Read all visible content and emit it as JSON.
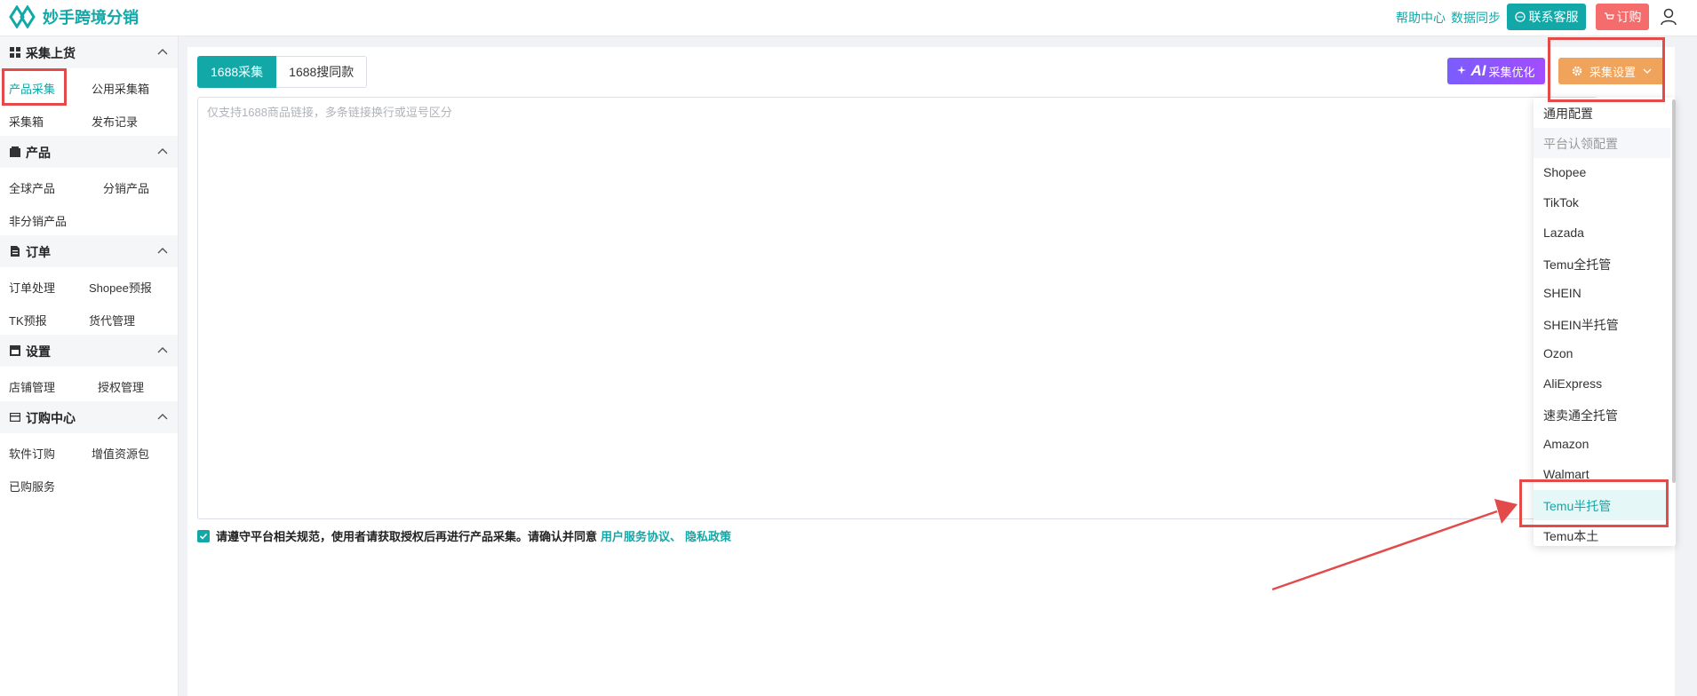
{
  "header": {
    "brand": "妙手跨境分销",
    "help_link": "帮助中心",
    "sync_link": "数据同步",
    "service_button": "联系客服",
    "order_button": "订购"
  },
  "sidebar": {
    "groups": [
      {
        "title": "采集上货",
        "items": [
          "产品采集",
          "公用采集箱",
          "采集箱",
          "发布记录"
        ]
      },
      {
        "title": "产品",
        "items": [
          "全球产品",
          "分销产品",
          "非分销产品"
        ]
      },
      {
        "title": "订单",
        "items": [
          "订单处理",
          "Shopee预报",
          "TK预报",
          "货代管理"
        ]
      },
      {
        "title": "设置",
        "items": [
          "店铺管理",
          "授权管理"
        ]
      },
      {
        "title": "订购中心",
        "items": [
          "软件订购",
          "增值资源包",
          "已购服务"
        ]
      }
    ],
    "active_item": "产品采集"
  },
  "main": {
    "tabs": [
      {
        "label": "1688采集",
        "active": true
      },
      {
        "label": "1688搜同款",
        "active": false
      }
    ],
    "ai_button": {
      "badge": "AI",
      "label": "采集优化"
    },
    "settings_button": "采集设置",
    "textarea_placeholder": "仅支持1688商品链接，多条链接换行或逗号区分",
    "agreement": {
      "checked": true,
      "text": "请遵守平台相关规范，使用者请获取授权后再进行产品采集。请确认并同意",
      "link_terms": "用户服务协议、",
      "link_privacy": "隐私政策"
    }
  },
  "dropdown": {
    "items": [
      {
        "label": "通用配置",
        "state": "normal"
      },
      {
        "label": "平台认领配置",
        "state": "disabled"
      },
      {
        "label": "Shopee",
        "state": "normal"
      },
      {
        "label": "TikTok",
        "state": "normal"
      },
      {
        "label": "Lazada",
        "state": "normal"
      },
      {
        "label": "Temu全托管",
        "state": "normal"
      },
      {
        "label": "SHEIN",
        "state": "normal"
      },
      {
        "label": "SHEIN半托管",
        "state": "normal"
      },
      {
        "label": "Ozon",
        "state": "normal"
      },
      {
        "label": "AliExpress",
        "state": "normal"
      },
      {
        "label": "速卖通全托管",
        "state": "normal"
      },
      {
        "label": "Amazon",
        "state": "normal"
      },
      {
        "label": "Walmart",
        "state": "normal"
      },
      {
        "label": "Temu半托管",
        "state": "hover"
      },
      {
        "label": "Temu本土",
        "state": "normal"
      }
    ]
  },
  "colors": {
    "primary": "#13a8a8",
    "order_red": "#f56c6c",
    "settings_orange": "#f0a35a",
    "ai_purple": "#7b5cff",
    "annotation_red": "#e34b4b"
  }
}
